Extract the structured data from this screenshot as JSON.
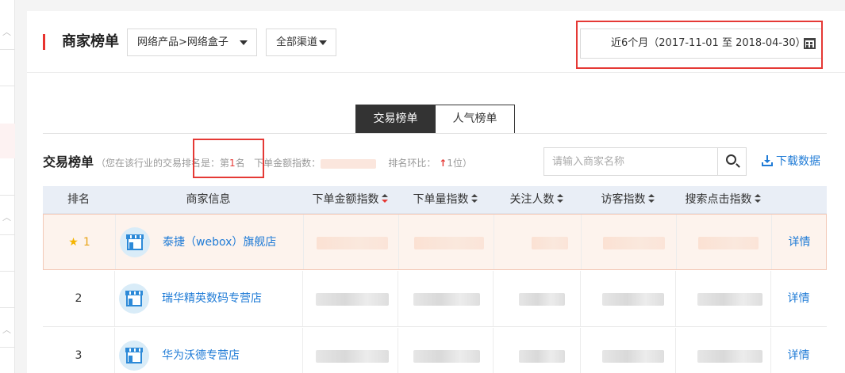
{
  "header": {
    "title": "商家榜单",
    "product_dropdown": "网络产品>网络盒子",
    "channel_dropdown": "全部渠道",
    "date_range": "近6个月（2017-11-01 至 2018-04-30）"
  },
  "tabs": [
    {
      "label": "交易榜单",
      "active": true
    },
    {
      "label": "人气榜单",
      "active": false
    }
  ],
  "section": {
    "title": "交易榜单",
    "rank_prefix": "（您在该行业的交易排名是：第",
    "rank_value": "1",
    "rank_suffix": "名",
    "order_index_label": "下单金额指数：",
    "rank_change_label": "排名环比：",
    "rank_change_arrow": "↑",
    "rank_change_value": "1位",
    "close_paren": "）"
  },
  "search": {
    "placeholder": "请输入商家名称"
  },
  "download_label": "下载数据",
  "table": {
    "columns": [
      "排名",
      "商家信息",
      "下单金额指数",
      "下单量指数",
      "关注人数",
      "访客指数",
      "搜索点击指数"
    ],
    "rows": [
      {
        "rank": "1",
        "name": "泰捷（webox）旗舰店",
        "detail": "详情",
        "highlight": true
      },
      {
        "rank": "2",
        "name": "瑞华精英数码专营店",
        "detail": "详情",
        "highlight": false
      },
      {
        "rank": "3",
        "name": "华为沃德专营店",
        "detail": "详情",
        "highlight": false
      }
    ]
  },
  "colors": {
    "accent_red": "#e8332f",
    "link_blue": "#1f7bd6",
    "star_gold": "#f5b400",
    "header_bg": "#e9eef6",
    "highlight_row": "#fdf3ed"
  }
}
